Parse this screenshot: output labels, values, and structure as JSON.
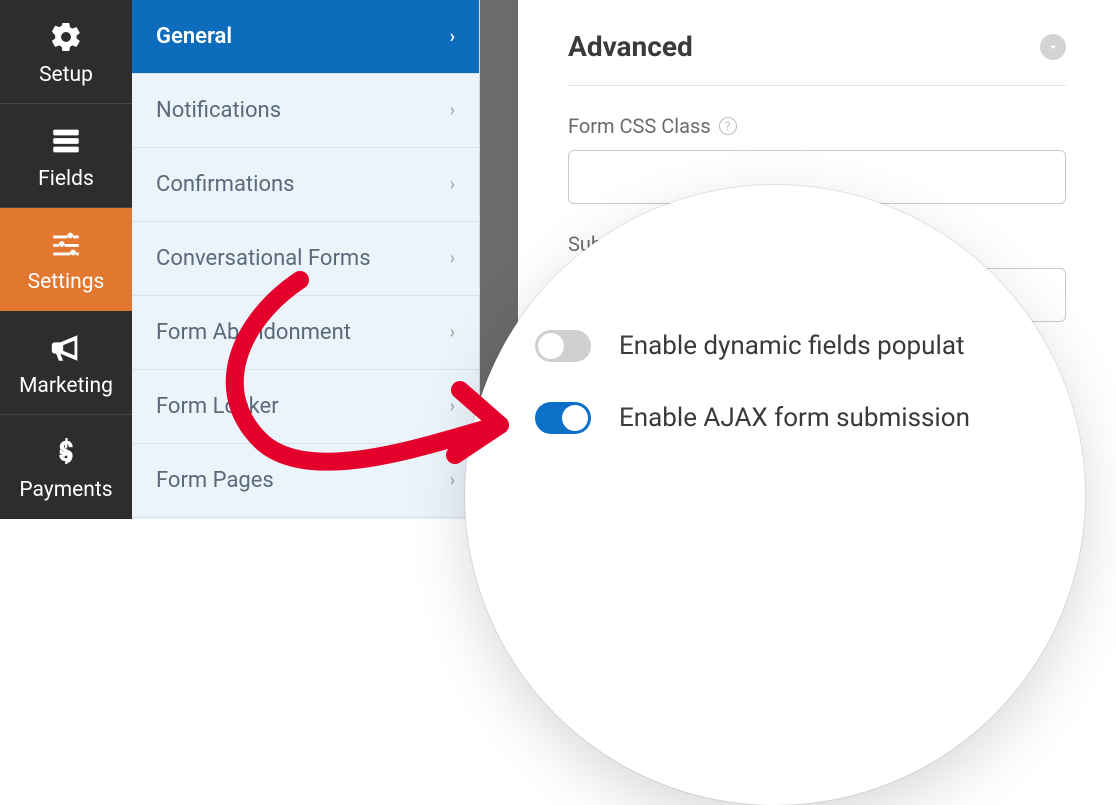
{
  "vnav": {
    "items": [
      {
        "label": "Setup"
      },
      {
        "label": "Fields"
      },
      {
        "label": "Settings"
      },
      {
        "label": "Marketing"
      },
      {
        "label": "Payments"
      }
    ],
    "active_index": 2
  },
  "settings_list": {
    "items": [
      {
        "label": "General"
      },
      {
        "label": "Notifications"
      },
      {
        "label": "Confirmations"
      },
      {
        "label": "Conversational Forms"
      },
      {
        "label": "Form Abandonment"
      },
      {
        "label": "Form Locker"
      },
      {
        "label": "Form Pages"
      }
    ],
    "active_index": 0
  },
  "panel": {
    "title": "Advanced",
    "fields": {
      "css_class": {
        "label": "Form CSS Class",
        "value": ""
      },
      "submit_btn": {
        "label": "Submit Button CSS Class",
        "label_partial": "Submit P",
        "value": ""
      }
    },
    "toggles": {
      "dynamic": {
        "label": "Enable dynamic fields populat",
        "on": false
      },
      "ajax": {
        "label": "Enable AJAX form submission",
        "on": true
      }
    }
  },
  "colors": {
    "accent_orange": "#e27730",
    "accent_blue": "#0e6cbd"
  }
}
